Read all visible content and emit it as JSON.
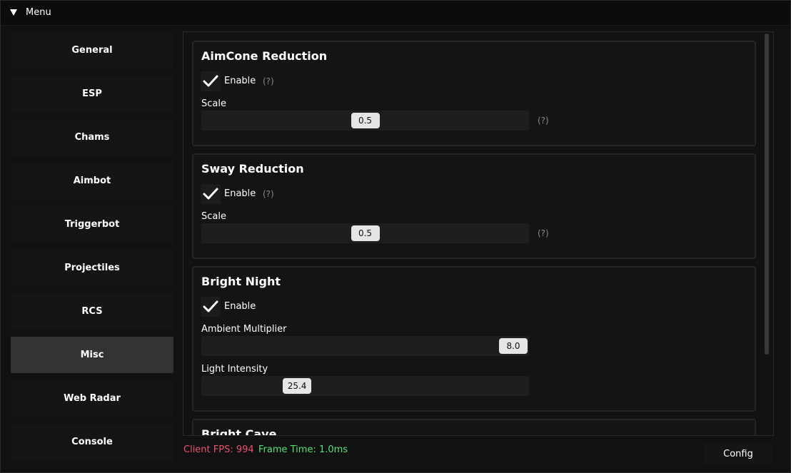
{
  "window": {
    "title": "Menu"
  },
  "sidebar": {
    "items": [
      {
        "label": "General"
      },
      {
        "label": "ESP"
      },
      {
        "label": "Chams"
      },
      {
        "label": "Aimbot"
      },
      {
        "label": "Triggerbot"
      },
      {
        "label": "Projectiles"
      },
      {
        "label": "RCS"
      },
      {
        "label": "Misc",
        "active": true
      },
      {
        "label": "Web Radar"
      },
      {
        "label": "Console"
      }
    ]
  },
  "sections": {
    "aimcone": {
      "title": "AimCone Reduction",
      "enable_label": "Enable",
      "enable_checked": true,
      "help": "(?)",
      "scale_label": "Scale",
      "scale_value": "0.5",
      "scale_fraction": 0.5,
      "scale_help": "(?)"
    },
    "sway": {
      "title": "Sway Reduction",
      "enable_label": "Enable",
      "enable_checked": true,
      "help": "(?)",
      "scale_label": "Scale",
      "scale_value": "0.5",
      "scale_fraction": 0.5,
      "scale_help": "(?)"
    },
    "bright_night": {
      "title": "Bright Night",
      "enable_label": "Enable",
      "enable_checked": true,
      "ambient_label": "Ambient Multiplier",
      "ambient_value": "8.0",
      "ambient_fraction": 1.0,
      "light_label": "Light Intensity",
      "light_value": "25.4",
      "light_fraction": 0.27
    },
    "bright_cave": {
      "title": "Bright Cave"
    }
  },
  "footer": {
    "fps": "Client FPS: 994",
    "frame_time": "Frame Time: 1.0ms",
    "config_label": "Config"
  },
  "colors": {
    "fps": "#e8546c",
    "frame_time": "#56e07a",
    "active_nav": "#333333"
  },
  "icons": {
    "collapse": "triangle-down-icon",
    "check": "checkmark-icon"
  }
}
